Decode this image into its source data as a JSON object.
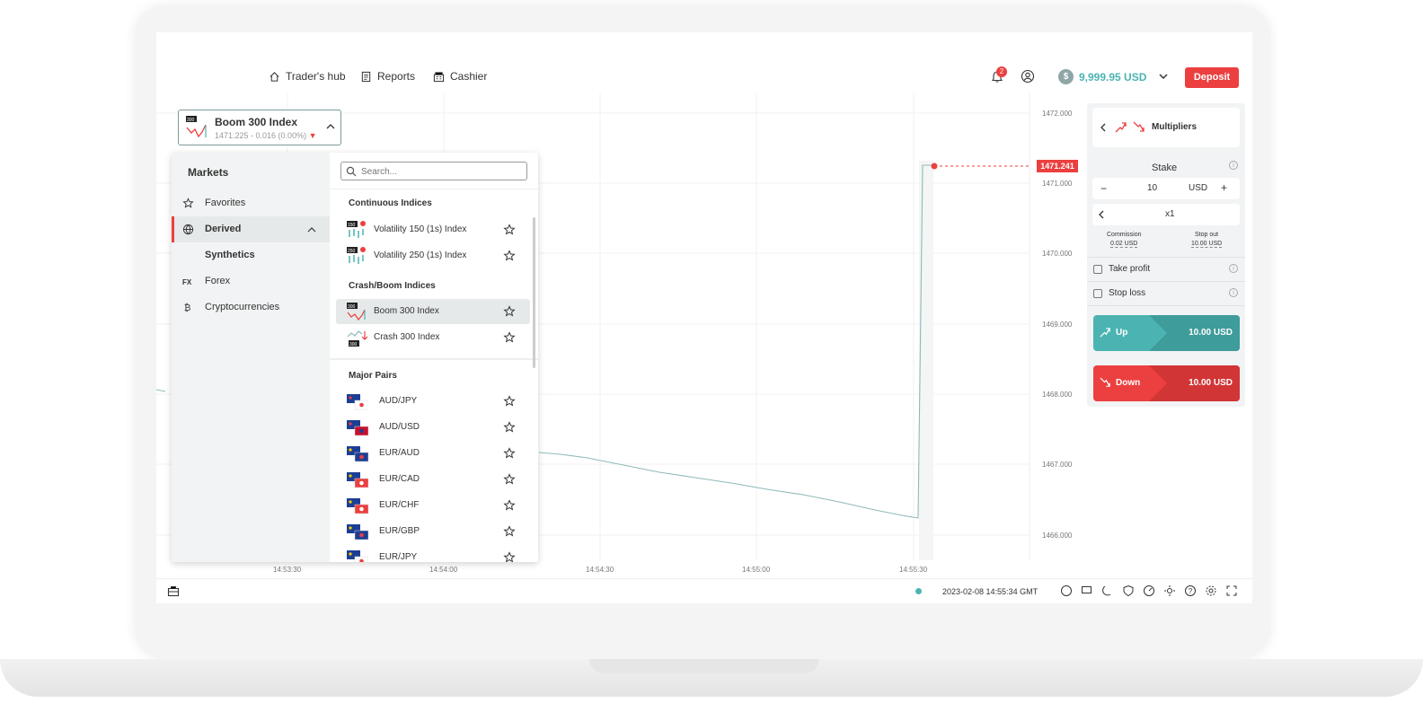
{
  "header": {
    "nav": [
      {
        "label": "Trader's hub",
        "icon": "home-icon"
      },
      {
        "label": "Reports",
        "icon": "reports-icon"
      },
      {
        "label": "Cashier",
        "icon": "cashier-icon"
      }
    ],
    "notification_count": "2",
    "balance": "9,999.95 USD",
    "deposit_label": "Deposit"
  },
  "selector": {
    "title": "Boom 300 Index",
    "price_line": "1471.225 - 0.016 (0.00%)"
  },
  "markets": {
    "heading": "Markets",
    "search_placeholder": "Search...",
    "categories": [
      {
        "label": "Favorites",
        "icon": "star-icon"
      },
      {
        "label": "Derived",
        "icon": "globe-icon"
      },
      {
        "label": "Synthetics",
        "icon": ""
      },
      {
        "label": "Forex",
        "icon": "fx-icon"
      },
      {
        "label": "Cryptocurrencies",
        "icon": "crypto-icon"
      }
    ],
    "groups": [
      {
        "title": "Continuous Indices",
        "items": [
          "Volatility 150 (1s) Index",
          "Volatility 250 (1s) Index"
        ],
        "badges": [
          "150",
          "250"
        ]
      },
      {
        "title": "Crash/Boom Indices",
        "items": [
          "Boom 300 Index",
          "Crash 300 Index"
        ],
        "badges": [
          "300",
          "300"
        ]
      },
      {
        "title": "Major Pairs",
        "items": [
          "AUD/JPY",
          "AUD/USD",
          "EUR/AUD",
          "EUR/CAD",
          "EUR/CHF",
          "EUR/GBP",
          "EUR/JPY"
        ]
      }
    ]
  },
  "chart": {
    "y_ticks": [
      "1472.000",
      "1471.000",
      "1470.000",
      "1469.000",
      "1468.000",
      "1467.000",
      "1466.000"
    ],
    "x_ticks": [
      "14:53:30",
      "14:54:00",
      "14:54:30",
      "14:55:00",
      "14:55:30"
    ],
    "current_price": "1471.241",
    "timestamp": "2023-02-08 14:55:34 GMT"
  },
  "trade": {
    "type_label": "Multipliers",
    "stake_label": "Stake",
    "stake_value": "10",
    "currency": "USD",
    "multiplier": "x1",
    "commission_label": "Commission",
    "commission_value": "0.02 USD",
    "stopout_label": "Stop out",
    "stopout_value": "10.00 USD",
    "take_profit": "Take profit",
    "stop_loss": "Stop loss",
    "up_label": "Up",
    "up_amount": "10.00 USD",
    "down_label": "Down",
    "down_amount": "10.00 USD"
  },
  "colors": {
    "accent_red": "#ec3f3f",
    "accent_teal": "#4bb4b3"
  }
}
